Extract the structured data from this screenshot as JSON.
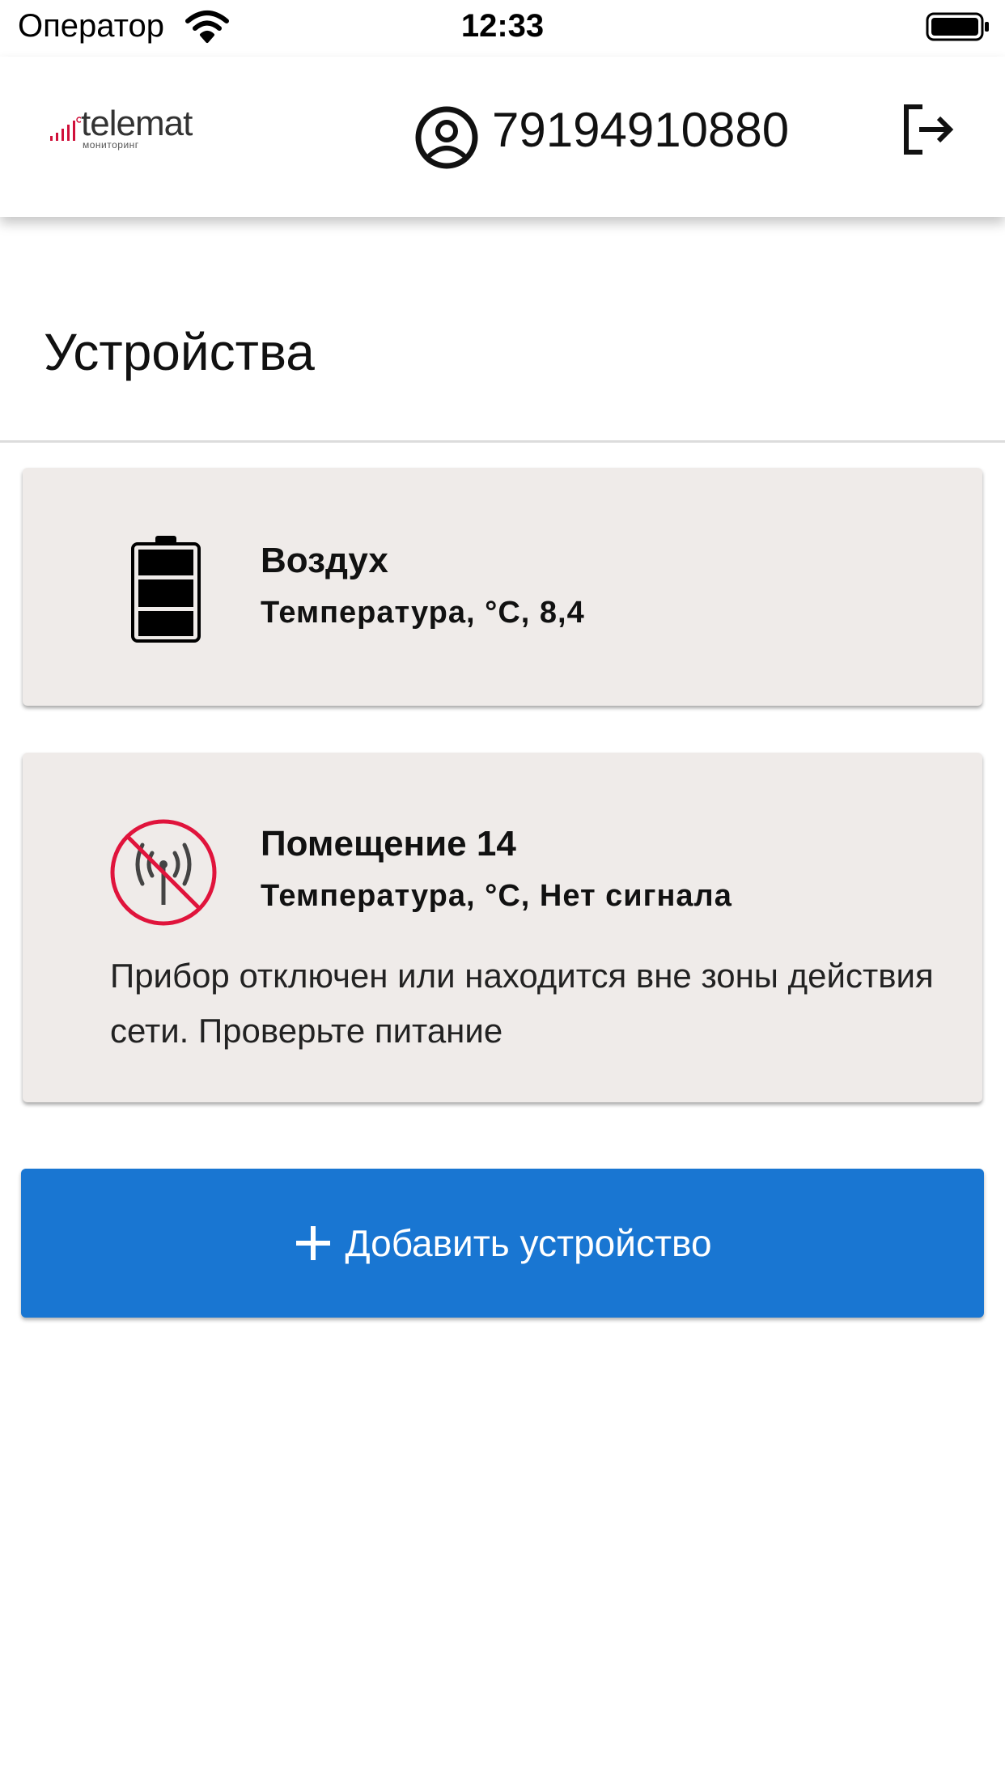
{
  "status_bar": {
    "carrier": "Оператор",
    "time": "12:33"
  },
  "header": {
    "logo_text": "telemat",
    "logo_subtext": "мониторинг",
    "phone": "79194910880"
  },
  "page": {
    "title": "Устройства"
  },
  "devices": [
    {
      "name": "Воздух",
      "reading": "Температура, °С, 8,4",
      "icon": "battery-full-icon"
    },
    {
      "name": "Помещение 14",
      "reading": "Температура, °С, Нет сигнала",
      "message": "Прибор отключен или находится вне зоны действия сети. Проверьте питание",
      "icon": "no-signal-icon"
    }
  ],
  "add_button": {
    "label": "Добавить устройство"
  },
  "colors": {
    "primary": "#1976d2",
    "card_bg": "#efebe9",
    "alert": "#e0143c"
  }
}
